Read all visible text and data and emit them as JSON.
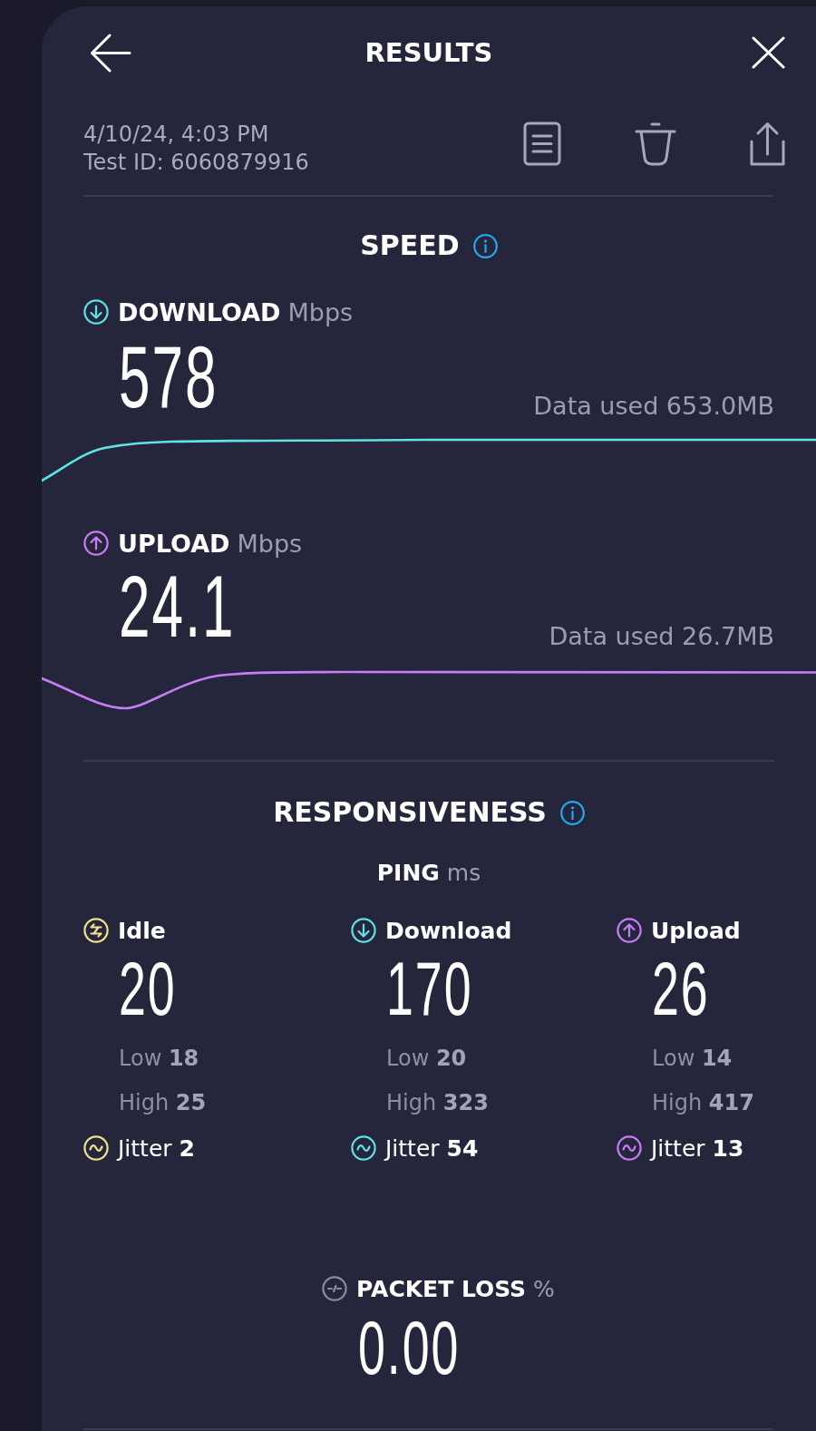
{
  "header": {
    "title": "RESULTS"
  },
  "test_info": {
    "date": "4/10/24, 4:03 PM",
    "test_id": "Test ID: 6060879916"
  },
  "speed": {
    "title": "SPEED",
    "metrics": [
      {
        "kind": "download",
        "label": "DOWNLOAD",
        "unit": "Mbps",
        "value": "578",
        "data_used": "Data used 653.0MB",
        "color": "#5fe3e4"
      },
      {
        "kind": "upload",
        "label": "UPLOAD",
        "unit": "Mbps",
        "value": "24.1",
        "data_used": "Data used 26.7MB",
        "color": "#c67ef7"
      }
    ]
  },
  "responsiveness": {
    "title": "RESPONSIVENESS",
    "ping": {
      "label": "PING",
      "unit": "ms"
    },
    "columns": [
      {
        "kind": "idle",
        "label": "Idle",
        "value": "20",
        "low": "Low **18**",
        "high": "High **25**",
        "jitter": "Jitter **2**",
        "color": "#f1e38b"
      },
      {
        "kind": "download",
        "label": "Download",
        "value": "170",
        "low": "Low **20**",
        "high": "High **323**",
        "jitter": "Jitter **54**",
        "color": "#5fe3e4"
      },
      {
        "kind": "upload",
        "label": "Upload",
        "value": "26",
        "low": "Low **14**",
        "high": "High **417**",
        "jitter": "Jitter **13**",
        "color": "#c67ef7"
      }
    ]
  },
  "packet_loss": {
    "label": "PACKET LOSS",
    "unit": "%",
    "value": "0.00"
  }
}
